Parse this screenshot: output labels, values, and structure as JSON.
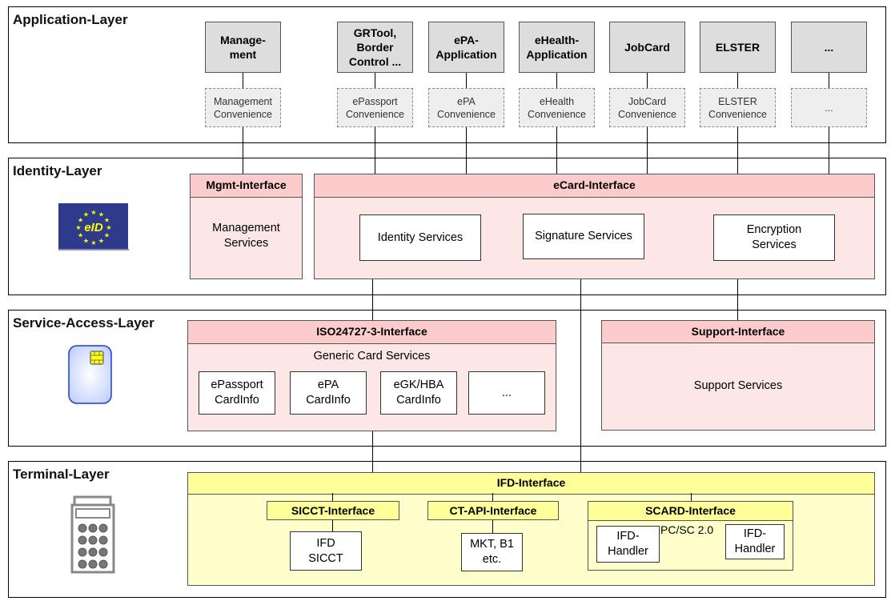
{
  "layers": {
    "application": "Application-Layer",
    "identity": "Identity-Layer",
    "service_access": "Service-Access-Layer",
    "terminal": "Terminal-Layer"
  },
  "applications": [
    {
      "name": "Manage-\nment",
      "convenience": "Management\nConvenience"
    },
    {
      "name": "GRTool,\nBorder\nControl ...",
      "convenience": "ePassport\nConvenience"
    },
    {
      "name": "ePA-\nApplication",
      "convenience": "ePA\nConvenience"
    },
    {
      "name": "eHealth-\nApplication",
      "convenience": "eHealth\nConvenience"
    },
    {
      "name": "JobCard",
      "convenience": "JobCard\nConvenience"
    },
    {
      "name": "ELSTER",
      "convenience": "ELSTER\nConvenience"
    },
    {
      "name": "...",
      "convenience": "..."
    }
  ],
  "identity": {
    "logo_text": "eID",
    "mgmt_interface": "Mgmt-Interface",
    "mgmt_services": "Management\nServices",
    "ecard_interface": "eCard-Interface",
    "services": [
      "Identity Services",
      "Signature Services",
      "Encryption\nServices"
    ]
  },
  "service_access": {
    "iso_interface": "ISO24727-3-Interface",
    "generic": "Generic Card Services",
    "cardinfos": [
      "ePassport\nCardInfo",
      "ePA\nCardInfo",
      "eGK/HBA\nCardInfo",
      "..."
    ],
    "support_interface": "Support-Interface",
    "support_services": "Support Services"
  },
  "terminal": {
    "ifd_interface": "IFD-Interface",
    "sicct_interface": "SICCT-Interface",
    "ctapi_interface": "CT-API-Interface",
    "scard_interface": "SCARD-Interface",
    "ifd_sicct": "IFD\nSICCT",
    "mkt": "MKT, B1\netc.",
    "pcsc": "PC/SC 2.0",
    "ifd_handler_1": "IFD-\nHandler",
    "ifd_handler_2": "IFD-\nHandler"
  },
  "colors": {
    "pink_header": "#fccccc",
    "pink_body": "#fde6e6",
    "yellow_header": "#ffff99",
    "yellow_body": "#ffffcc",
    "eu_blue": "#2e3a8c",
    "star": "#ffff00"
  }
}
